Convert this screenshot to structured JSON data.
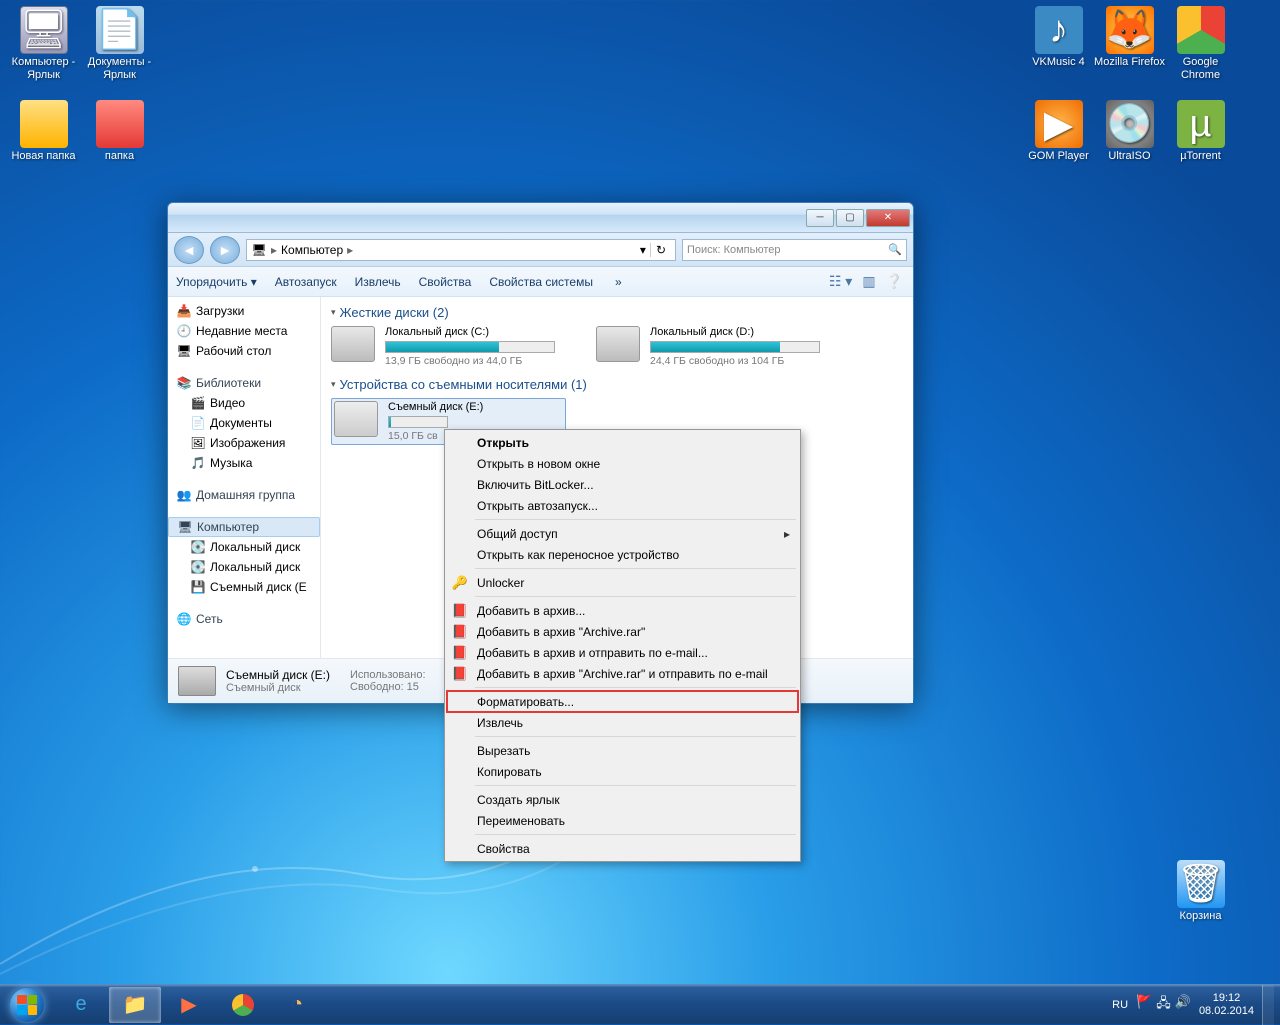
{
  "desktop": {
    "left": [
      {
        "name": "Компьютер - Ярлык",
        "ico": "ico-computer"
      },
      {
        "name": "Документы - Ярлык",
        "ico": "ico-docs"
      },
      {
        "name": "Новая папка",
        "ico": "ico-folder"
      },
      {
        "name": "папка",
        "ico": "ico-folder red"
      }
    ],
    "right": [
      {
        "name": "VKMusic 4",
        "ico": "ico-vk"
      },
      {
        "name": "Mozilla Firefox",
        "ico": "ico-ff"
      },
      {
        "name": "Google Chrome",
        "ico": "ico-chrome"
      },
      {
        "name": "GOM Player",
        "ico": "ico-gom"
      },
      {
        "name": "UltraISO",
        "ico": "ico-iso"
      },
      {
        "name": "µTorrent",
        "ico": "ico-ut"
      }
    ],
    "bin": "Корзина"
  },
  "explorer": {
    "breadcrumb": "Компьютер",
    "search_placeholder": "Поиск: Компьютер",
    "toolbar": {
      "organize": "Упорядочить",
      "autorun": "Автозапуск",
      "eject": "Извлечь",
      "props": "Свойства",
      "sysprops": "Свойства системы"
    },
    "sidebar": {
      "downloads": "Загрузки",
      "recent": "Недавние места",
      "desktop": "Рабочий стол",
      "libs": "Библиотеки",
      "video": "Видео",
      "docs": "Документы",
      "images": "Изображения",
      "music": "Музыка",
      "homegroup": "Домашняя группа",
      "computer": "Компьютер",
      "ldC": "Локальный диск",
      "ldD": "Локальный диск",
      "rem": "Съемный диск (E",
      "network": "Сеть"
    },
    "groups": {
      "hd": "Жесткие диски (2)",
      "removable": "Устройства со съемными носителями (1)"
    },
    "drives": {
      "c": {
        "name": "Локальный диск (C:)",
        "stat": "13,9 ГБ свободно из 44,0 ГБ",
        "fill": 67
      },
      "d": {
        "name": "Локальный диск  (D:)",
        "stat": "24,4 ГБ свободно из 104 ГБ",
        "fill": 77
      },
      "e": {
        "name": "Съемный диск (E:)",
        "stat": "15,0 ГБ св",
        "fill": 3
      }
    },
    "details": {
      "name": "Съемный диск (E:)",
      "type": "Съемный диск",
      "used_lbl": "Использовано:",
      "free_lbl": "Свободно: 15"
    }
  },
  "context": [
    {
      "label": "Открыть",
      "bold": true
    },
    {
      "label": "Открыть в новом окне"
    },
    {
      "label": "Включить BitLocker..."
    },
    {
      "label": "Открыть автозапуск..."
    },
    {
      "sep": true
    },
    {
      "label": "Общий доступ",
      "sub": true
    },
    {
      "label": "Открыть как переносное устройство"
    },
    {
      "sep": true
    },
    {
      "label": "Unlocker",
      "ico": "🔑"
    },
    {
      "sep": true
    },
    {
      "label": "Добавить в архив...",
      "ico": "📕"
    },
    {
      "label": "Добавить в архив \"Archive.rar\"",
      "ico": "📕"
    },
    {
      "label": "Добавить в архив и отправить по e-mail...",
      "ico": "📕"
    },
    {
      "label": "Добавить в архив \"Archive.rar\" и отправить по e-mail",
      "ico": "📕"
    },
    {
      "sep": true
    },
    {
      "label": "Форматировать...",
      "hl": true
    },
    {
      "label": "Извлечь"
    },
    {
      "sep": true
    },
    {
      "label": "Вырезать"
    },
    {
      "label": "Копировать"
    },
    {
      "sep": true
    },
    {
      "label": "Создать ярлык"
    },
    {
      "label": "Переименовать"
    },
    {
      "sep": true
    },
    {
      "label": "Свойства"
    }
  ],
  "taskbar": {
    "lang": "RU",
    "time": "19:12",
    "date": "08.02.2014"
  }
}
